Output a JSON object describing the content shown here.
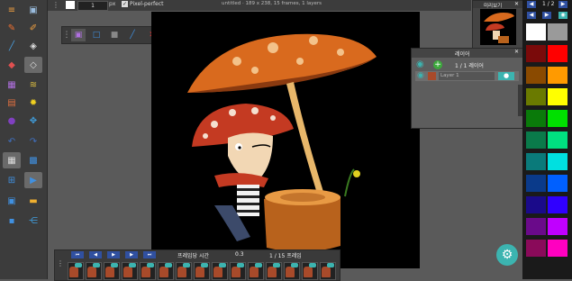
{
  "top_bar": {
    "brush_size": "1",
    "unit": "px",
    "pixel_perfect_label": "Pixel-perfect",
    "doc_info": "untitled · 189 x 238, 15 frames, 1 layers"
  },
  "preview": {
    "title": "미리보기"
  },
  "layers": {
    "title": "레이어",
    "count": "1 / 1 레이어",
    "layer_name": "Layer 1"
  },
  "frames": {
    "time_label": "프레임당 시간",
    "time_value": "0.3",
    "frame_count": "1 / 15 프레임"
  },
  "palette_header": {
    "page": "1 / 2"
  },
  "colors": {
    "accent": "#3cb4b0",
    "palette": [
      "#ffffff",
      "#9a9a9a",
      "#7a0a0a",
      "#ff0000",
      "#8a4a00",
      "#ff9a00",
      "#6a7a00",
      "#ffff00",
      "#0a7a0a",
      "#00e000",
      "#0a7a4a",
      "#00e080",
      "#0a7a7a",
      "#00e0e0",
      "#0a3a8a",
      "#0060ff",
      "#1a0a8a",
      "#3000ff",
      "#6a0a8a",
      "#c000ff",
      "#8a0a5a",
      "#ff00c0"
    ]
  }
}
